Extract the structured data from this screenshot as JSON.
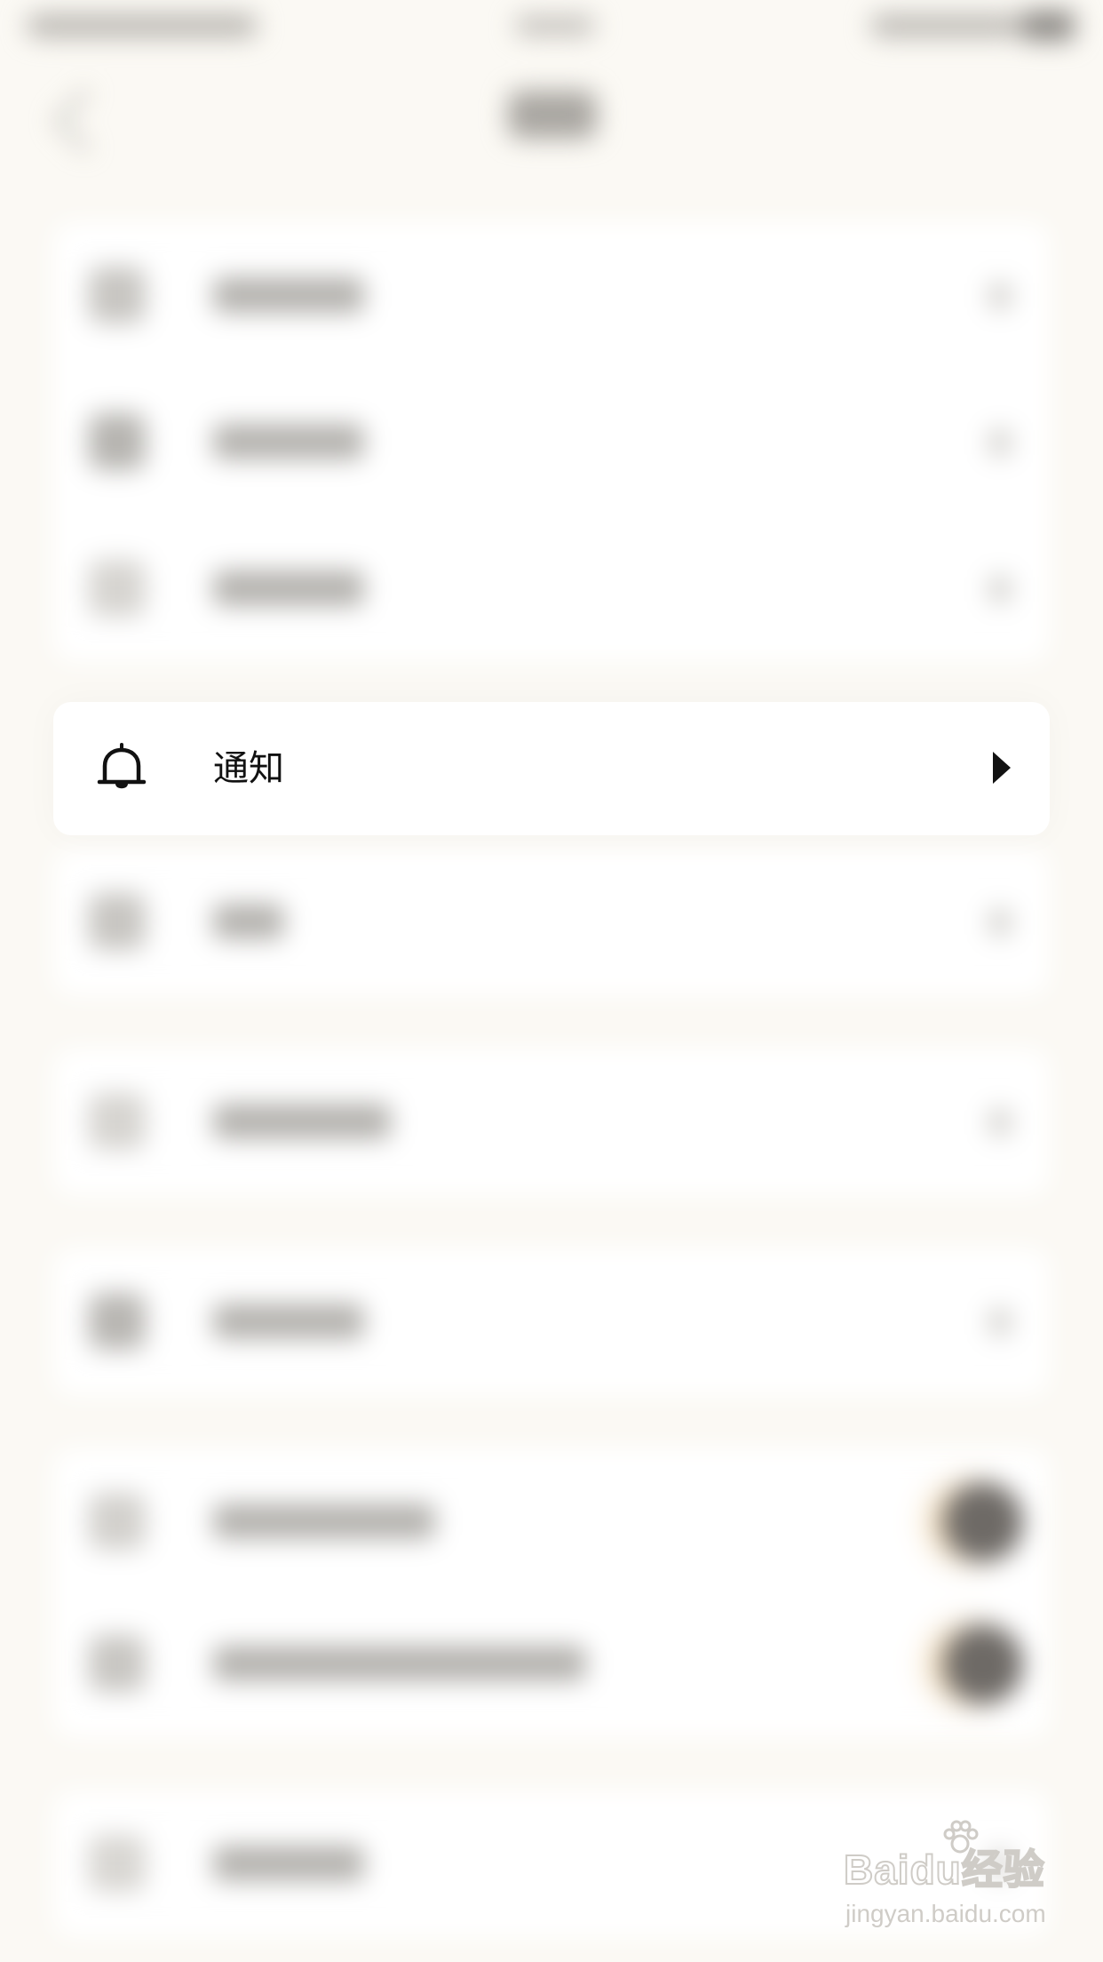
{
  "notification_item": {
    "label": "通知",
    "icon": "bell-icon",
    "chevron": "chevron-right-icon"
  },
  "blurred_rows": [
    {
      "group": 1,
      "index": 0
    },
    {
      "group": 1,
      "index": 1
    },
    {
      "group": 1,
      "index": 2
    },
    {
      "group": 2,
      "index": 0
    },
    {
      "group": 3,
      "index": 0
    },
    {
      "group": 4,
      "index": 0
    },
    {
      "group": 5,
      "index": 0
    },
    {
      "group": 5,
      "index": 1
    },
    {
      "group": 6,
      "index": 0
    }
  ],
  "watermark": {
    "brand": "Baidu经验",
    "url": "jingyan.baidu.com"
  },
  "colors": {
    "background": "#fbf9f4",
    "card": "#ffffff",
    "text": "#111111"
  }
}
